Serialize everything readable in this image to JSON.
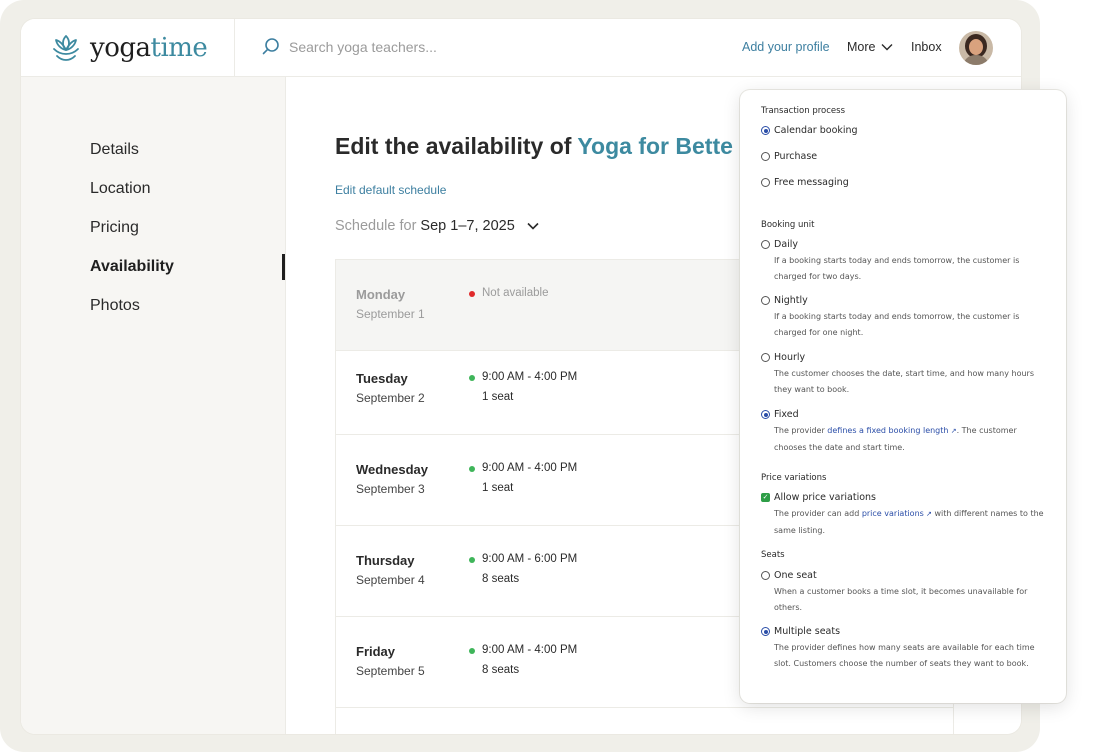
{
  "app": {
    "logo_main": "yoga",
    "logo_accent": "time"
  },
  "header": {
    "search_placeholder": "Search yoga teachers...",
    "add_profile": "Add your profile",
    "more": "More",
    "inbox": "Inbox"
  },
  "sidebar": {
    "items": [
      {
        "label": "Details"
      },
      {
        "label": "Location"
      },
      {
        "label": "Pricing"
      },
      {
        "label": "Availability"
      },
      {
        "label": "Photos"
      }
    ]
  },
  "main": {
    "title_prefix": "Edit the availability of ",
    "title_listing": "Yoga for Bette",
    "edit_default": "Edit default schedule",
    "schedule_for_label": "Schedule for",
    "schedule_range": "Sep 1–7, 2025",
    "days": [
      {
        "name": "Monday",
        "date": "September 1",
        "time": "Not available",
        "seats": "",
        "available": false
      },
      {
        "name": "Tuesday",
        "date": "September 2",
        "time": "9:00 AM - 4:00 PM",
        "seats": "1 seat",
        "available": true
      },
      {
        "name": "Wednesday",
        "date": "September 3",
        "time": "9:00 AM - 4:00 PM",
        "seats": "1 seat",
        "available": true
      },
      {
        "name": "Thursday",
        "date": "September 4",
        "time": "9:00 AM - 6:00 PM",
        "seats": "8 seats",
        "available": true
      },
      {
        "name": "Friday",
        "date": "September 5",
        "time": "9:00 AM - 4:00 PM",
        "seats": "8 seats",
        "available": true
      }
    ]
  },
  "panel": {
    "transaction": {
      "label": "Transaction process",
      "options": [
        "Calendar booking",
        "Purchase",
        "Free messaging"
      ],
      "selected": "Calendar booking"
    },
    "booking_unit": {
      "label": "Booking unit",
      "daily": "Daily",
      "daily_desc": "If a booking starts today and ends tomorrow, the customer is charged for two days.",
      "nightly": "Nightly",
      "nightly_desc": "If a booking starts today and ends tomorrow, the customer is charged for one night.",
      "hourly": "Hourly",
      "hourly_desc": "The customer chooses the date, start time, and how many hours they want to book.",
      "fixed": "Fixed",
      "fixed_desc_a": "The provider ",
      "fixed_desc_link": "defines a fixed booking length",
      "fixed_desc_b": ". The customer chooses the date and start time.",
      "selected": "Fixed"
    },
    "price_variations": {
      "label": "Price variations",
      "checkbox": "Allow price variations",
      "checked": true,
      "desc_a": "The provider can add ",
      "desc_link": "price variations",
      "desc_b": " with different names to the same listing."
    },
    "seats": {
      "label": "Seats",
      "one": "One seat",
      "one_desc": "When a customer books a time slot, it becomes unavailable for others.",
      "multiple": "Multiple seats",
      "multiple_desc": "The provider defines how many seats are available for each time slot. Customers choose the number of seats they want to book.",
      "selected": "Multiple seats"
    }
  },
  "colors": {
    "accent": "#3d8aa0",
    "link": "#3d7fa0",
    "available_dot": "#3fb55a",
    "unavailable_dot": "#e02a2a",
    "radio_selected": "#2b4ea8"
  }
}
